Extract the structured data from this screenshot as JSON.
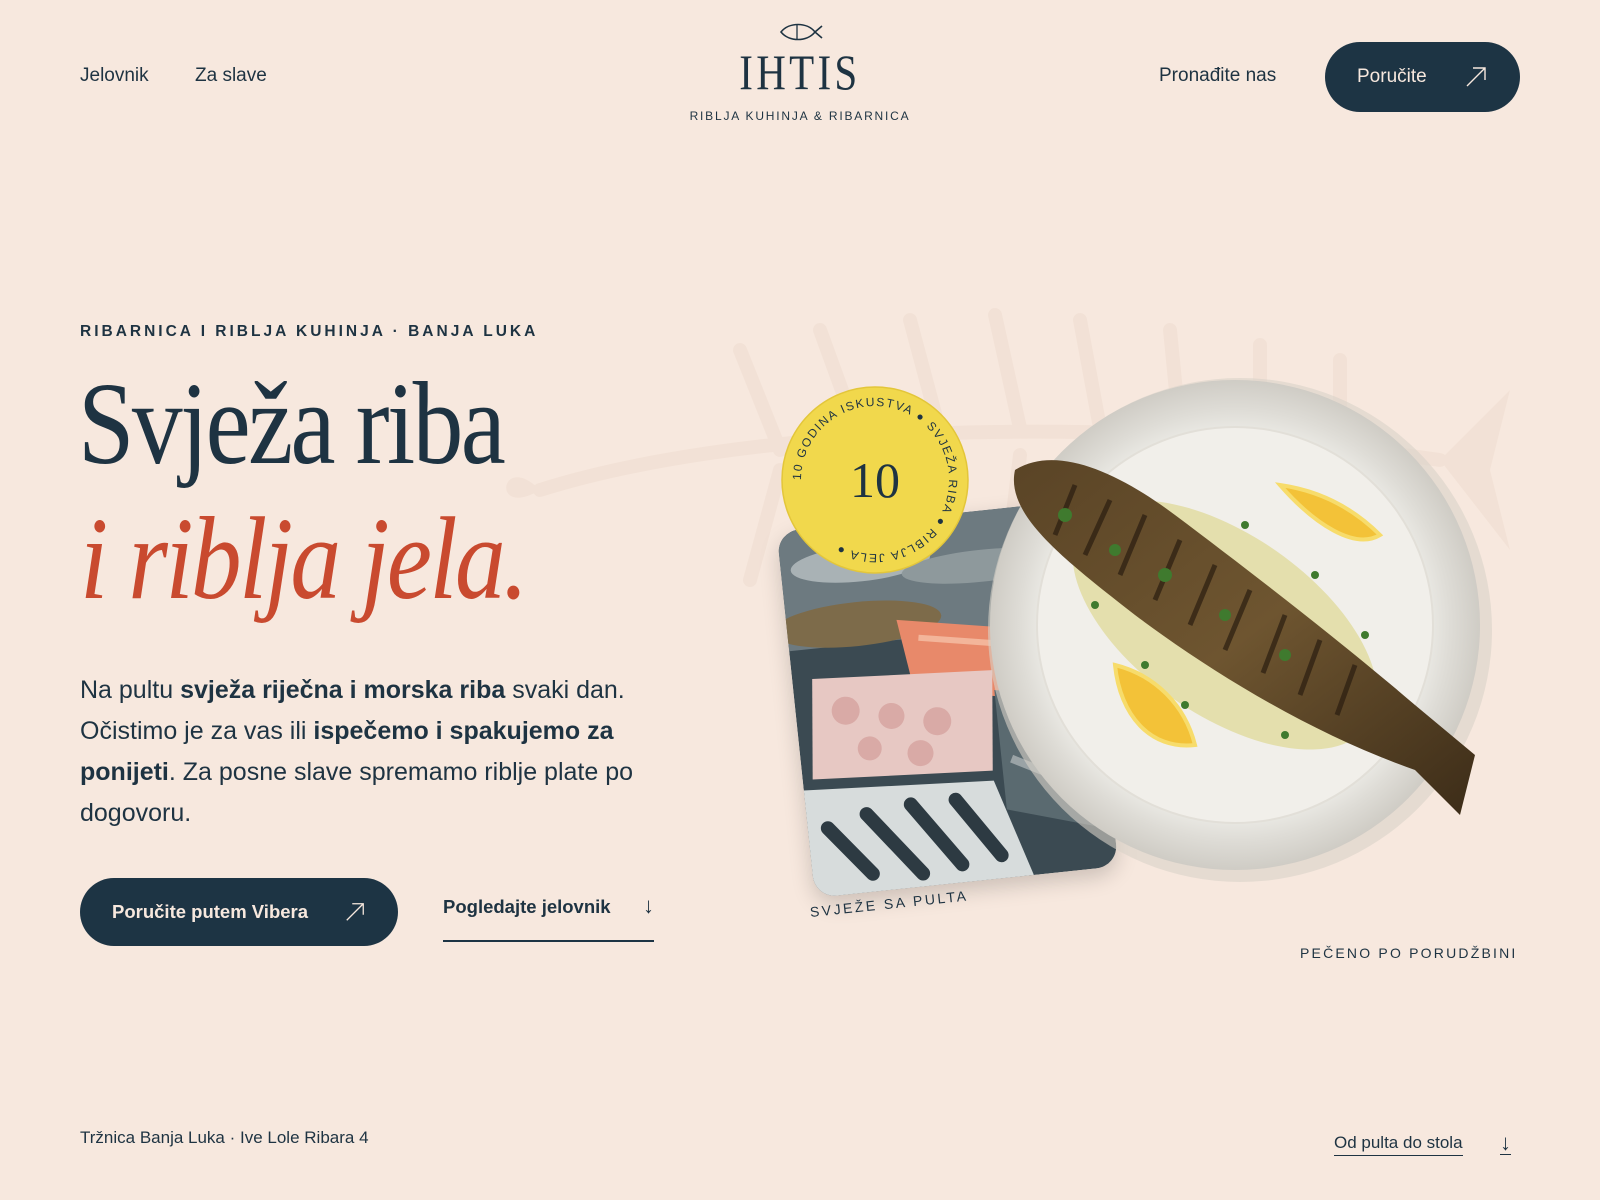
{
  "nav": {
    "menu": "Jelovnik",
    "slave": "Za slave",
    "find": "Pronađite nas",
    "order": "Poručite"
  },
  "logo": {
    "word": "IHTIS",
    "subtitle": "RIBLJA KUHINJA & RIBARNICA"
  },
  "hero": {
    "eyebrow": "RIBARNICA I RIBLJA KUHINJA · BANJA LUKA",
    "title_line1": "Svježa riba",
    "title_line2": "i riblja jela.",
    "lead_1": "Na pultu ",
    "lead_bold_1": "svježa riječna i morska riba",
    "lead_2": " svaki dan. Očistimo je za vas ili ",
    "lead_bold_2": "ispečemo i spakujemo za ponijeti",
    "lead_3": ". Za posne slave spremamo riblje plate po dogovoru.",
    "cta_primary": "Poručite putem Vibera",
    "cta_secondary": "Pogledajte jelovnik"
  },
  "badge": {
    "number": "10",
    "ring_text": "10 GODINA ISKUSTVA ● SVJEŽA RIBA ● RIBLJA JELA ●"
  },
  "captions": {
    "counter": "SVJEŽE SA PULTA",
    "plate": "PEČENO PO PORUDŽBINI"
  },
  "footer": {
    "address": "Tržnica Banja Luka · Ive Lole Ribara 4",
    "scroll": "Od pulta do stola"
  },
  "colors": {
    "background": "#f7e8de",
    "navy": "#1d3444",
    "accent": "#c94a2f",
    "badge": "#f1d84c"
  }
}
